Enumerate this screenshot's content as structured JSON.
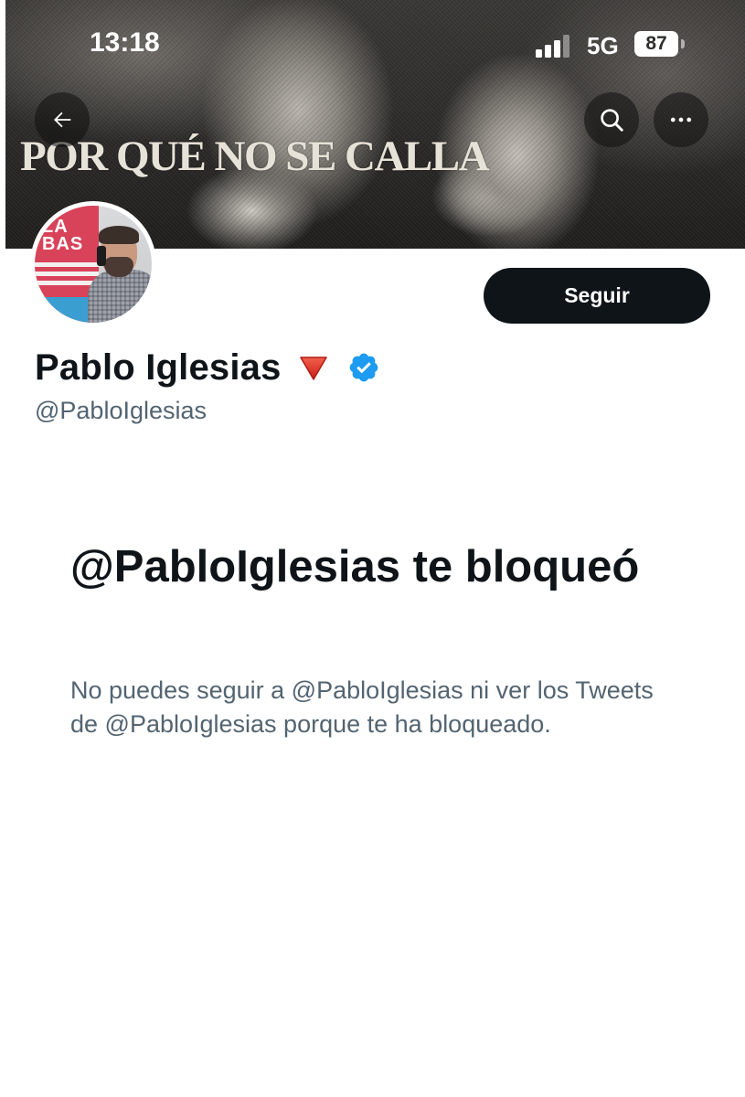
{
  "status_bar": {
    "time": "13:18",
    "network": "5G",
    "battery": "87"
  },
  "banner": {
    "headline": "POR QUÉ NO SE CALLA"
  },
  "avatar": {
    "logo_text": "LA BAS"
  },
  "profile": {
    "display_name": "Pablo Iglesias",
    "handle": "@PabloIglesias",
    "follow_label": "Seguir"
  },
  "blocked": {
    "title": "@PabloIglesias te bloqueó",
    "description": "No puedes seguir a @PabloIglesias ni ver los Tweets de @PabloIglesias porque te ha bloqueado."
  },
  "icons": {
    "back": "arrow-left-icon",
    "search": "search-icon",
    "more": "more-horizontal-icon",
    "emoji": "red-triangle-down-icon",
    "verified": "verified-badge-icon"
  },
  "colors": {
    "primary_text": "#0f1419",
    "secondary_text": "#536471",
    "verified_blue": "#1d9bf0",
    "button_bg": "#0f1419",
    "triangle_red": "#e0302a"
  }
}
